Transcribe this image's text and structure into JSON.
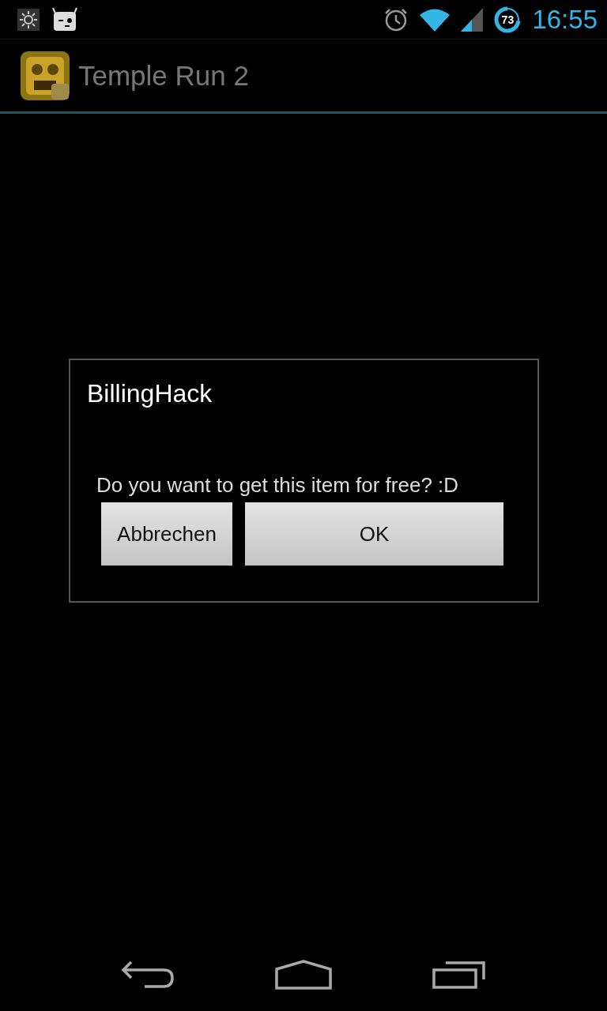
{
  "status_bar": {
    "battery": "73",
    "time": "16:55"
  },
  "action_bar": {
    "title": "Temple Run 2"
  },
  "dialog": {
    "title": "BillingHack",
    "message": "Do you want to get this item for free? :D",
    "buttons": [
      {
        "label": "Abbrechen",
        "kind": "negative"
      },
      {
        "label": "OK",
        "kind": "positive"
      }
    ]
  }
}
